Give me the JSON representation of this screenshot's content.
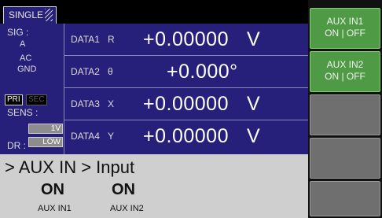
{
  "tab": {
    "label": "SINGLE"
  },
  "status": {
    "sig_label": "SIG :",
    "sig_input": "A",
    "sig_coupling": "AC",
    "sig_ground": "GND",
    "pri_label": "PRI",
    "sec_label": "SEC",
    "sens_label": "SENS :",
    "sens_value": "1V",
    "dr_label": "DR :",
    "dr_value": "LOW"
  },
  "data_rows": [
    {
      "label": "DATA1",
      "symbol": "R",
      "value": "+0.00000",
      "unit": "V"
    },
    {
      "label": "DATA2",
      "symbol": "θ",
      "value": "+0.000°",
      "unit": ""
    },
    {
      "label": "DATA3",
      "symbol": "X",
      "value": "+0.00000",
      "unit": "V"
    },
    {
      "label": "DATA4",
      "symbol": "Y",
      "value": "+0.00000",
      "unit": "V"
    }
  ],
  "menu": {
    "breadcrumb": "> AUX IN > Input",
    "aux1_state": "ON",
    "aux1_label": "AUX IN1",
    "aux2_state": "ON",
    "aux2_label": "AUX IN2"
  },
  "softkeys": [
    {
      "line1": "AUX IN1",
      "line2": "ON | OFF",
      "active": true
    },
    {
      "line1": "AUX IN2",
      "line2": "ON | OFF",
      "active": true
    },
    {
      "line1": "",
      "line2": "",
      "active": false
    },
    {
      "line1": "",
      "line2": "",
      "active": false
    },
    {
      "line1": "",
      "line2": "",
      "active": false
    }
  ],
  "colors": {
    "panel_bg": "#27207a",
    "menu_bg": "#cfcfcf",
    "softkey_active": "#4f9b45",
    "softkey_inactive": "#6f6f6f"
  }
}
